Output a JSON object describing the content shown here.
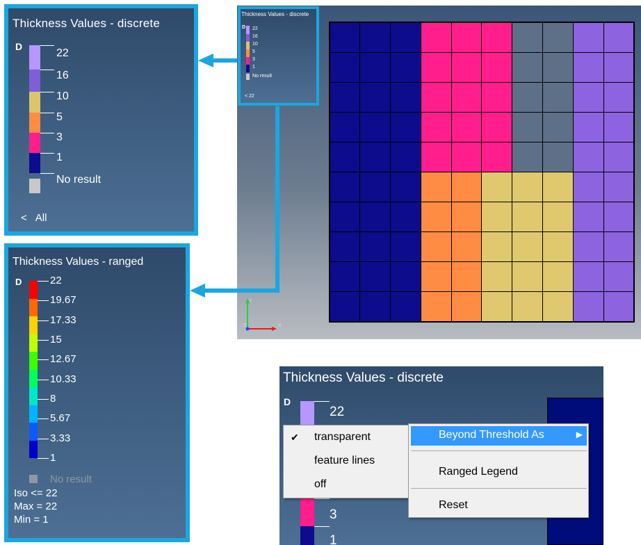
{
  "discrete_legend": {
    "title": "Thickness Values - discrete",
    "marker": "D",
    "entries": [
      {
        "label": "22",
        "color": "#b697ff"
      },
      {
        "label": "16",
        "color": "#7f5fd6"
      },
      {
        "label": "10",
        "color": "#d9c66a"
      },
      {
        "label": "5",
        "color": "#ff8c42"
      },
      {
        "label": "3",
        "color": "#ff1e8c"
      },
      {
        "label": "1",
        "color": "#0c0c8c"
      }
    ],
    "no_result": {
      "label": "No result",
      "color": "#c8c8c8"
    },
    "filter_arrow": "<",
    "filter_value": "All"
  },
  "ranged_legend": {
    "title": "Thickness Values - ranged",
    "marker": "D",
    "ticks": [
      "22",
      "19.67",
      "17.33",
      "15",
      "12.67",
      "10.33",
      "8",
      "5.67",
      "3.33",
      "1"
    ],
    "band_colors": [
      "#ff0000",
      "#ff6a00",
      "#ffd200",
      "#bfff00",
      "#3cff00",
      "#00ff5a",
      "#00e8c8",
      "#00b4ff",
      "#0a5aff",
      "#0000c8"
    ],
    "no_result": "No result",
    "iso": "Iso <= 22",
    "max": "Max =  22",
    "min": "Min =   1"
  },
  "mini_legend": {
    "title": "Thickness Values - discrete",
    "entries": [
      "22",
      "16",
      "10",
      "5",
      "3",
      "1",
      "No result"
    ],
    "filter": "<  22"
  },
  "mesh": {
    "colors": {
      "a": "#0c0c8c",
      "b": "#ff1e8c",
      "c": "#5e7088",
      "d": "#8d63df",
      "e": "#ff8c42",
      "f": "#e0c86e"
    },
    "rows": [
      "aaabbbccdd",
      "aaabbbccdd",
      "aaabbbccdd",
      "aaabbbccdd",
      "aaabbbccdd",
      "aaaeefffdd",
      "aaaeefffdd",
      "aaaeefffdd",
      "aaaeefffdd",
      "aaaeefffdd"
    ]
  },
  "triad": {
    "x": "X",
    "y": "Y",
    "z": "Z"
  },
  "context_view": {
    "title": "Thickness Values - discrete",
    "marker": "D",
    "labels": [
      "22",
      "3",
      "1"
    ],
    "submenu": [
      {
        "label": "transparent",
        "checked": "✔"
      },
      {
        "label": "feature lines",
        "checked": ""
      },
      {
        "label": "off",
        "checked": ""
      }
    ],
    "menu": {
      "beyond_threshold": "Beyond Threshold As",
      "ranged_legend": "Ranged Legend",
      "reset": "Reset",
      "submenu_arrow": "▶"
    }
  }
}
